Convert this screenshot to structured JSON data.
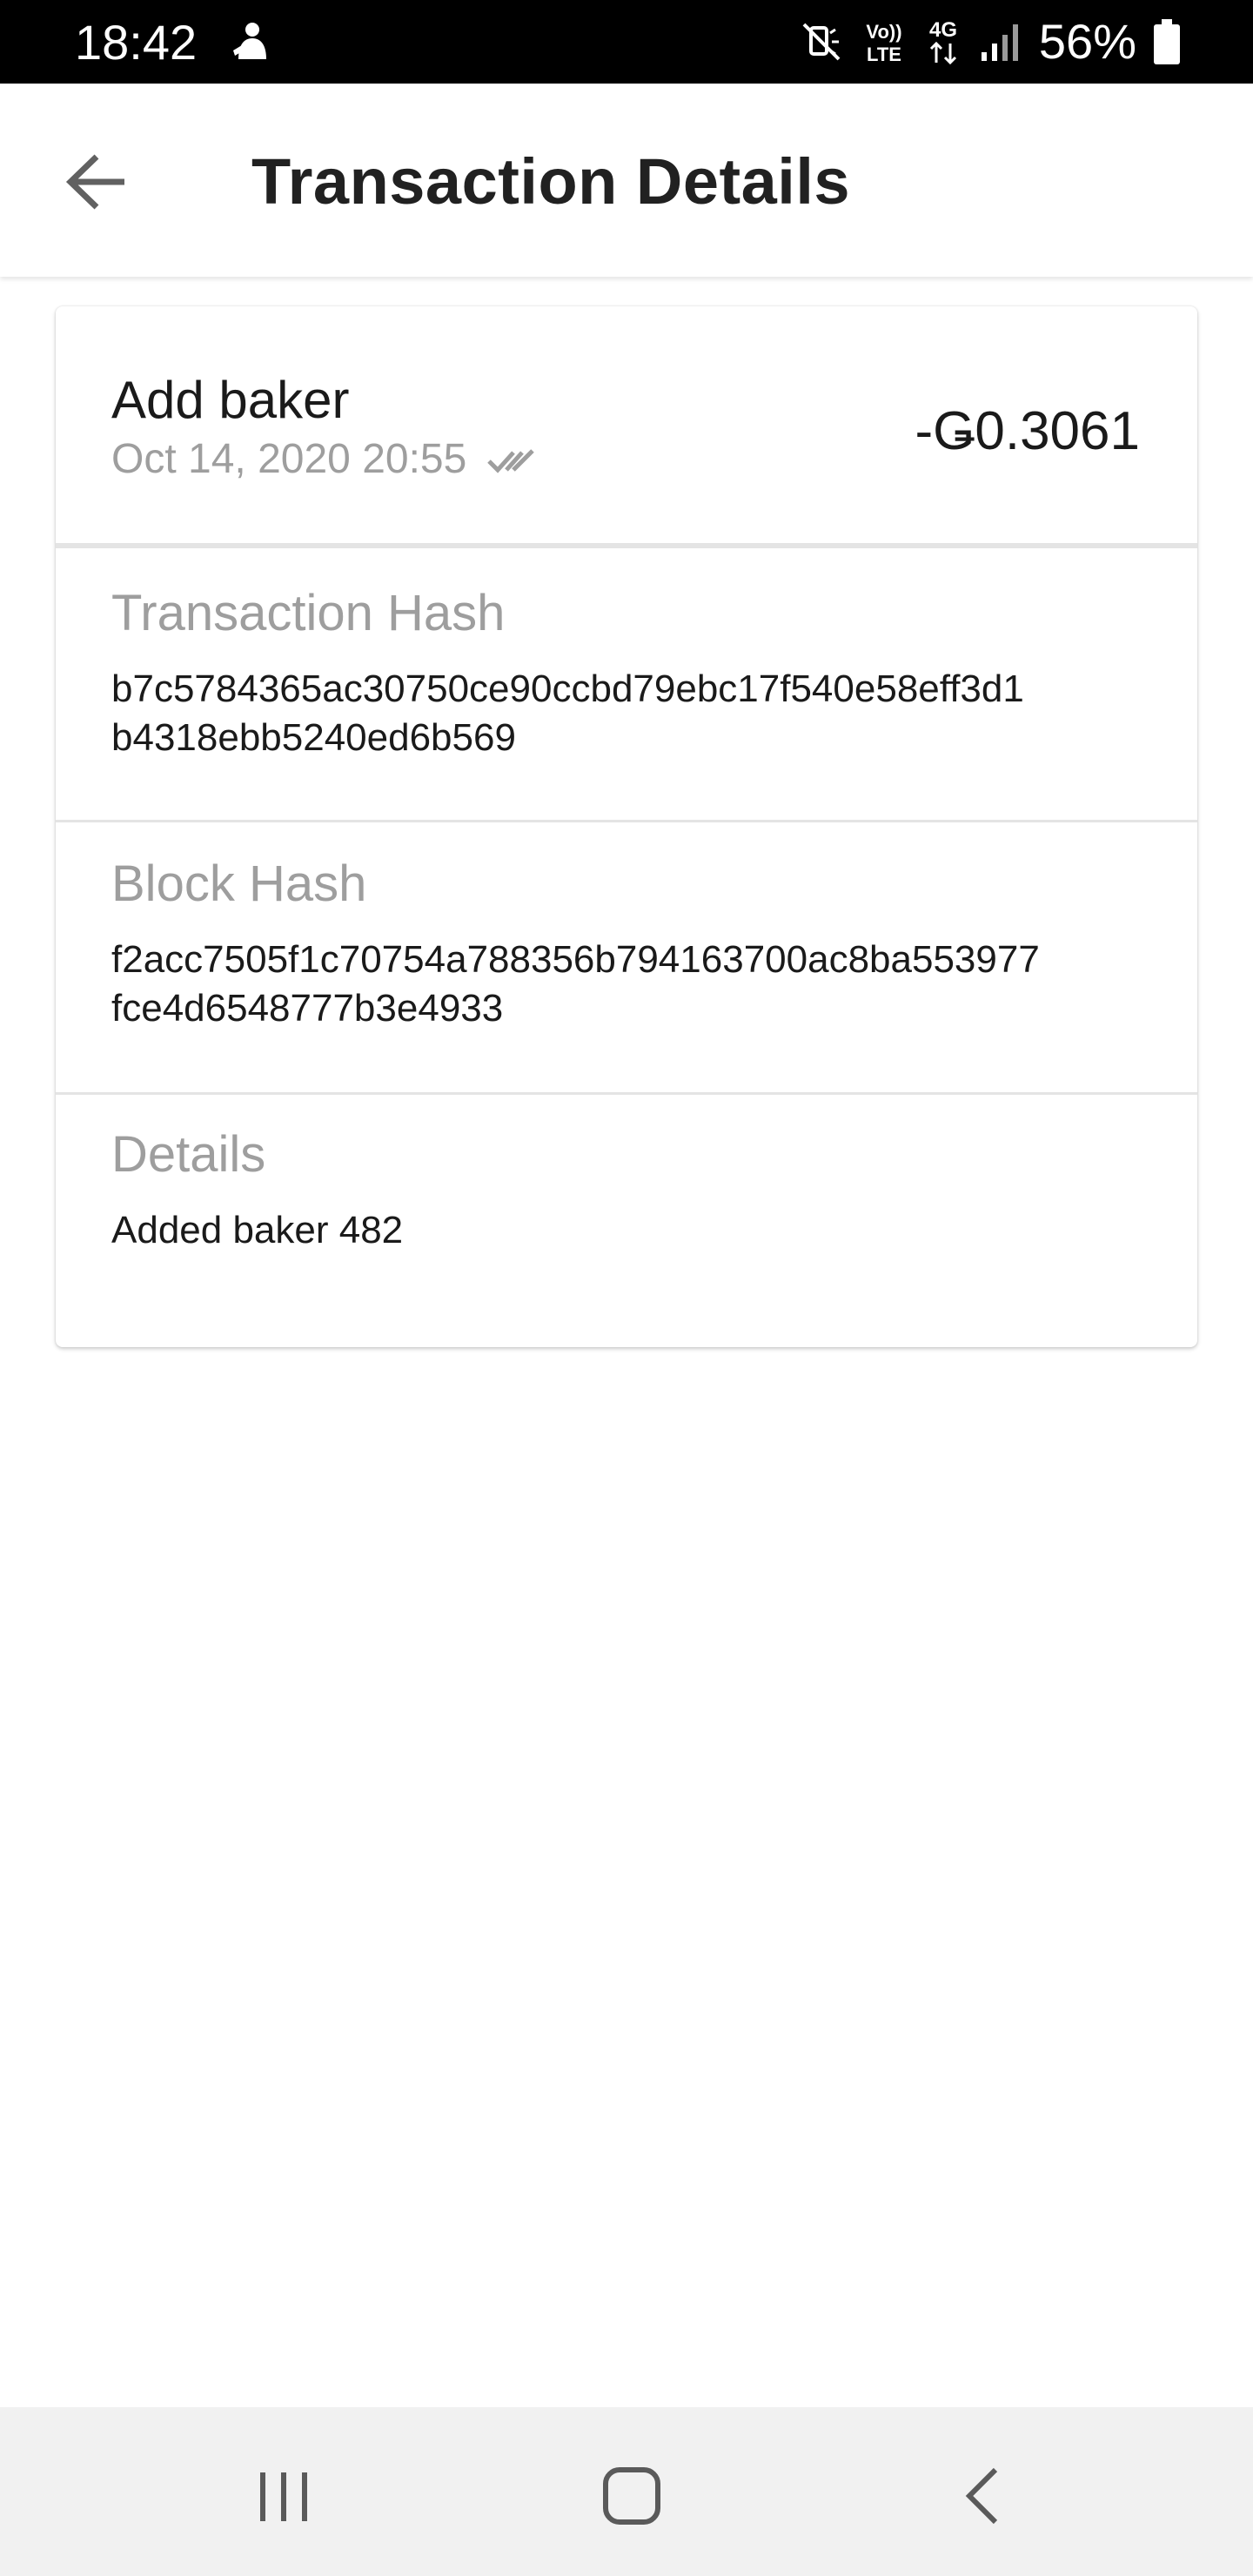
{
  "status_bar": {
    "time": "18:42",
    "battery_percent": "56%",
    "icons": [
      "person-notification-icon",
      "mute-icon",
      "volte-icon",
      "4g-icon",
      "signal-icon",
      "battery-icon"
    ],
    "volte_label_top": "Vo))",
    "volte_label_bottom": "LTE",
    "network_label": "4G"
  },
  "app_bar": {
    "title": "Transaction Details",
    "back_icon": "arrow-left-icon"
  },
  "transaction": {
    "title": "Add baker",
    "date": "Oct 14, 2020 20:55",
    "status_icon": "double-check-icon",
    "amount": "-Ǥ0.3061"
  },
  "fields": [
    {
      "label": "Transaction Hash",
      "value": "b7c5784365ac30750ce90ccbd79ebc17f540e58eff3d1\nb4318ebb5240ed6b569"
    },
    {
      "label": "Block Hash",
      "value": "f2acc7505f1c70754a788356b794163700ac8ba553977\nfce4d6548777b3e4933"
    },
    {
      "label": "Details",
      "value": "Added baker 482"
    }
  ],
  "nav_bar": {
    "icons": [
      "recent-apps-icon",
      "home-icon",
      "back-icon"
    ]
  },
  "colors": {
    "status_bar_bg": "#000000",
    "secondary_text": "#9e9e9e",
    "primary_text": "#1a1a1a",
    "divider": "#e4e4e4",
    "nav_bar_bg": "#f1f1f1"
  }
}
